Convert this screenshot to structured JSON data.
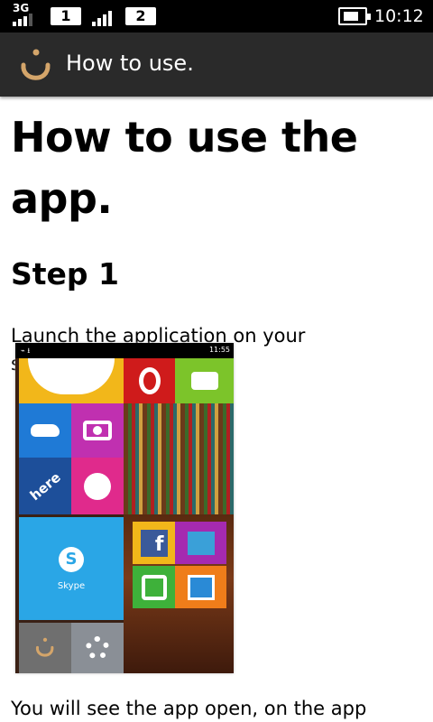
{
  "status_bar": {
    "network": "3G",
    "sim1": "1",
    "sim2": "2",
    "time": "10:12",
    "icons": [
      "signal-icon",
      "signal-icon",
      "battery-charging-icon"
    ]
  },
  "action_bar": {
    "title": "How to use.",
    "logo_icon": "nun-letter-logo",
    "logo_color": "#d4a56a"
  },
  "content": {
    "heading": "How to use the app.",
    "step_title": "Step 1",
    "step_text": "Launch the application on your smartphone.",
    "figure": {
      "status_time": "11:55",
      "skype_label": "Skype",
      "here_label": "here",
      "tiles": [
        "clock-tile",
        "opera-tile",
        "messages-tile",
        "onedrive-tile",
        "camera-tile",
        "photos-tile",
        "here-maps-tile",
        "smiley-tile",
        "skype-tile",
        "facebook-tile",
        "twitter-tile",
        "instagram-tile",
        "calendar-tile",
        "app-tile",
        "settings-tile"
      ]
    },
    "next_text": "You will see the app open, on the app"
  }
}
